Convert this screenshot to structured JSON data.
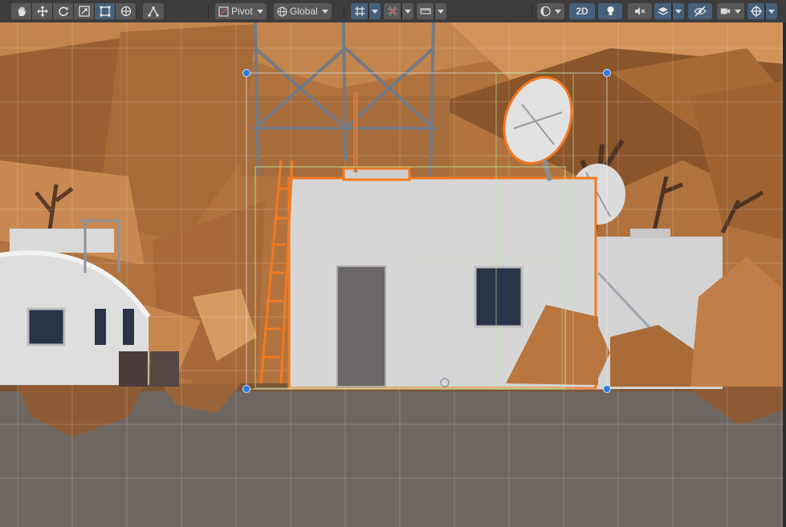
{
  "toolbar": {
    "tools": [
      {
        "name": "hand-tool",
        "icon": "hand-icon"
      },
      {
        "name": "move-tool",
        "icon": "move-arrows-icon"
      },
      {
        "name": "rotate-tool",
        "icon": "rotate-icon"
      },
      {
        "name": "scale-tool",
        "icon": "scale-icon"
      },
      {
        "name": "rect-tool",
        "icon": "rect-transform-icon",
        "active": true
      },
      {
        "name": "transform-tool",
        "icon": "transform-icon"
      },
      {
        "name": "custom-tool",
        "icon": "custom-tool-icon"
      }
    ],
    "pivot_label": "Pivot",
    "global_label": "Global",
    "mode_2d_label": "2D",
    "accent_color": "#46607c",
    "selection_color": "#f07a22"
  }
}
